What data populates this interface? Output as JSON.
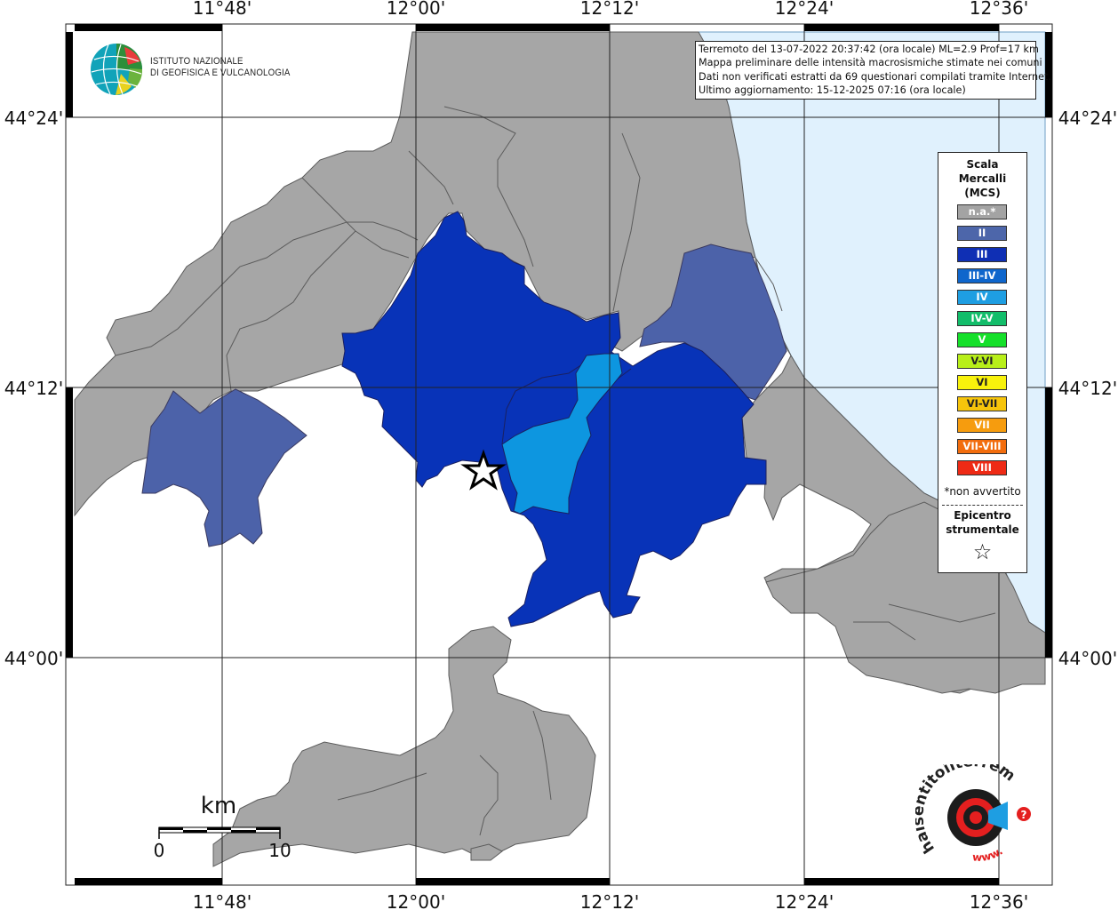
{
  "header": {
    "lines": [
      "Terremoto del 13-07-2022 20:37:42 (ora locale) ML=2.9 Prof=17 km",
      "Mappa preliminare delle intensità macrosismiche stimate nei comuni",
      "Dati non verificati estratti da 69 questionari compilati tramite Internet.",
      "Ultimo aggiornamento: 15-12-2025 07:16 (ora locale)"
    ]
  },
  "logo_ingv": {
    "line1": "ISTITUTO NAZIONALE",
    "line2": "DI GEOFISICA E VULCANOLOGIA"
  },
  "axes": {
    "lon_top": [
      "11°48'",
      "12°00'",
      "12°12'",
      "12°24'",
      "12°36'"
    ],
    "lon_bottom": [
      "11°48'",
      "12°00'",
      "12°12'",
      "12°24'",
      "12°36'"
    ],
    "lat_left": [
      "44°24'",
      "44°12'",
      "44°00'"
    ],
    "lat_right": [
      "44°24'",
      "44°12'",
      "44°00'"
    ]
  },
  "scale_bar": {
    "unit": "km",
    "start": "0",
    "end": "10"
  },
  "legend": {
    "title": [
      "Scala",
      "Mercalli",
      "(MCS)"
    ],
    "items": [
      {
        "label": "n.a.*",
        "color": "#a3a3a3"
      },
      {
        "label": "II",
        "color": "#4d66aa"
      },
      {
        "label": "III",
        "color": "#0f2fb4"
      },
      {
        "label": "III-IV",
        "color": "#0f66cc"
      },
      {
        "label": "IV",
        "color": "#1e9ee2"
      },
      {
        "label": "IV-V",
        "color": "#12bd6a"
      },
      {
        "label": "V",
        "color": "#15e02a"
      },
      {
        "label": "V-VI",
        "color": "#b8ef19"
      },
      {
        "label": "VI",
        "color": "#f8f20c"
      },
      {
        "label": "VI-VII",
        "color": "#f6c40b"
      },
      {
        "label": "VII",
        "color": "#f69c0e"
      },
      {
        "label": "VII-VIII",
        "color": "#f26d0e"
      },
      {
        "label": "VIII",
        "color": "#ee2a15"
      }
    ],
    "note": "*non avvertito",
    "epicenter_label": [
      "Epicentro",
      "strumentale"
    ],
    "epicenter_symbol": "☆"
  },
  "logo_hsit": {
    "text_main": "haisentitoilterremoto.it",
    "text_bottom": "www.",
    "question": "?"
  },
  "colors": {
    "na_gray": "#a6a6a6",
    "mcs_II": "#4c62a9",
    "mcs_III": "#0833b8",
    "mcs_IV": "#0d96e0",
    "sea": "#e0f1fd",
    "border": "#555555"
  }
}
